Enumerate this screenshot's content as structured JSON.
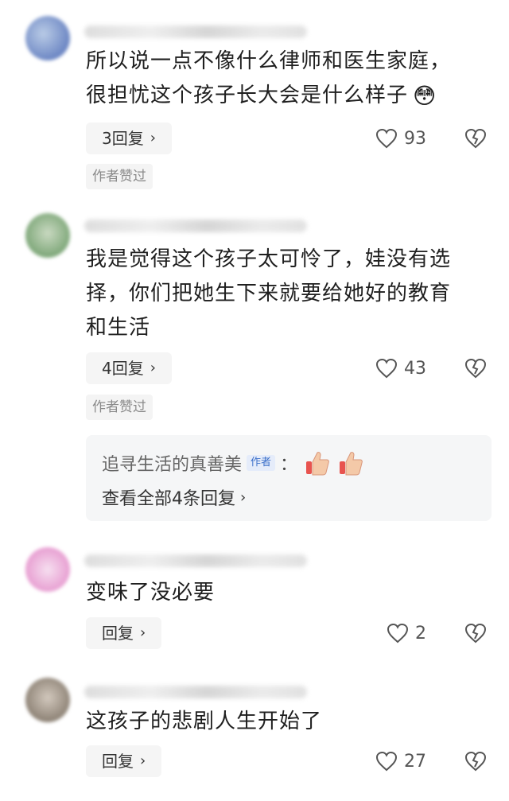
{
  "comments": [
    {
      "text_lines": [
        "所以说一点不像什么律师和医生家庭，",
        "很担忧这个孩子长大会是什么样子"
      ],
      "emoji": "😳",
      "reply_label": "3回复",
      "likes": "93",
      "author_liked": "作者赞过",
      "avatar_colors": [
        "#6d87c4",
        "#b9cbe6"
      ]
    },
    {
      "text_lines": [
        "我是觉得这个孩子太可怜了，娃没有选",
        "择，你们把她生下来就要给她好的教育",
        "和生活"
      ],
      "reply_label": "4回复",
      "likes": "43",
      "author_liked": "作者赞过",
      "avatar_colors": [
        "#7fa87a",
        "#c9d9c1"
      ],
      "sub_reply": {
        "author": "追寻生活的真善美",
        "author_tag": "作者",
        "colon": "：",
        "view_all": "查看全部4条回复"
      }
    },
    {
      "text_lines": [
        "变味了没必要"
      ],
      "reply_label": "回复",
      "likes": "2",
      "avatar_colors": [
        "#e79bd0",
        "#f6dff0"
      ]
    },
    {
      "text_lines": [
        "这孩子的悲剧人生开始了"
      ],
      "reply_label": "回复",
      "likes": "27",
      "avatar_colors": [
        "#8a7f72",
        "#d2c8bd"
      ]
    }
  ],
  "icons": {
    "like": "heart-outline-icon",
    "dislike": "broken-heart-icon",
    "chevron": "chevron-right-icon",
    "thumbs": "thumbs-up-icon"
  },
  "colors": {
    "author_tag": "#3b6fc9",
    "reply_bg": "#f5f5f5",
    "badge_text": "#8a8a8a"
  },
  "chevron_glyph": "›"
}
